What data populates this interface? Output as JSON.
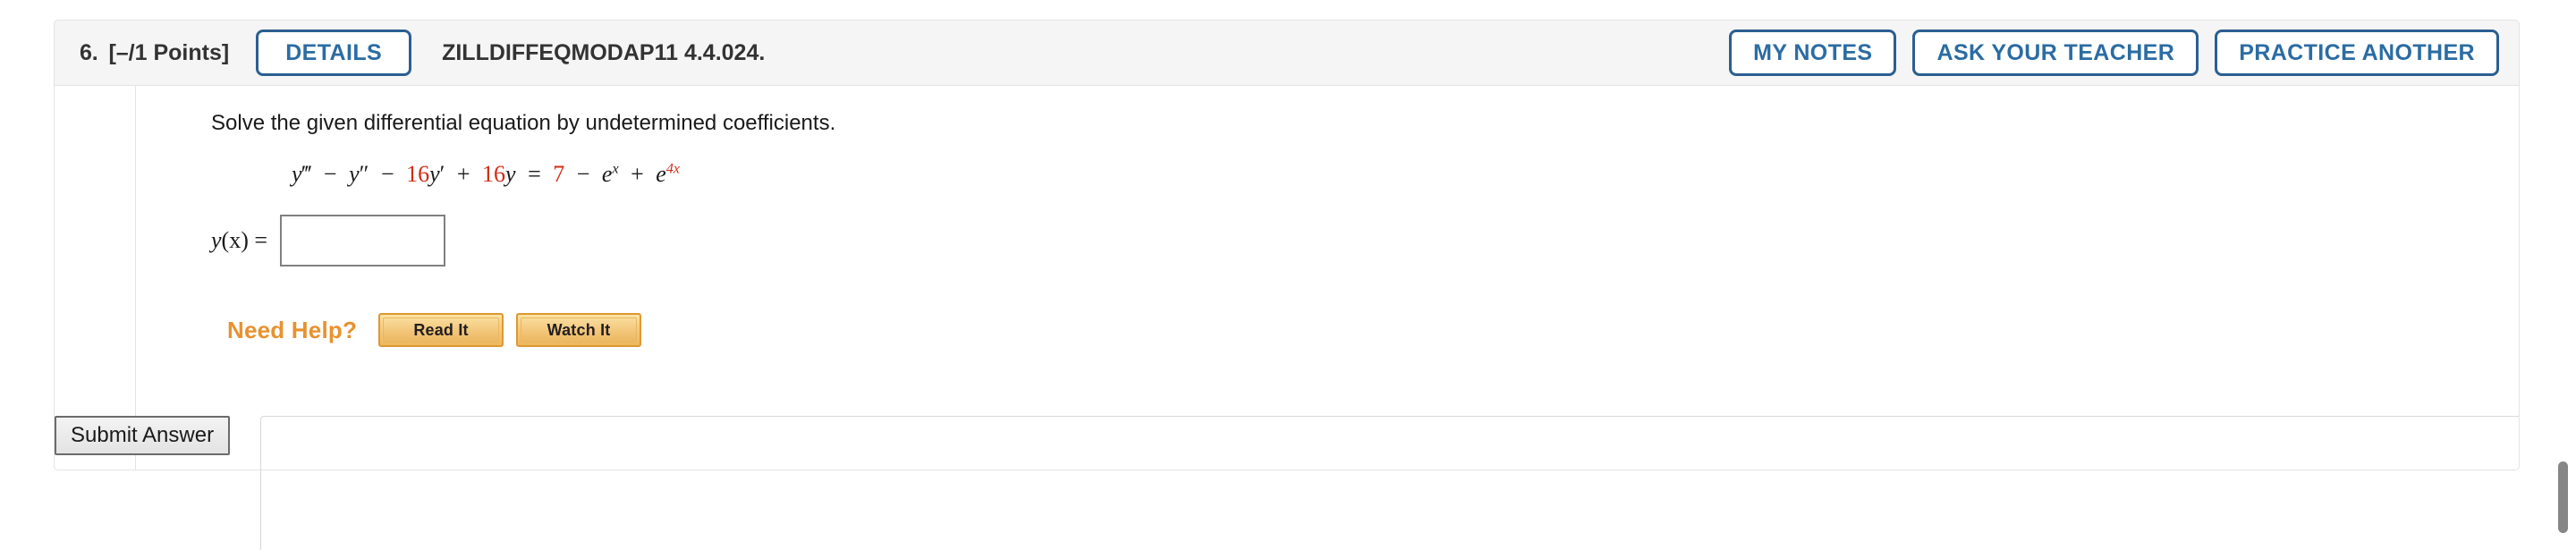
{
  "header": {
    "question_number": "6.",
    "points": "[–/1 Points]",
    "details_label": "DETAILS",
    "textbook_code": "ZILLDIFFEQMODAP11 4.4.024.",
    "right_buttons": [
      {
        "label": "MY NOTES",
        "name": "my-notes-button"
      },
      {
        "label": "ASK YOUR TEACHER",
        "name": "ask-your-teacher-button"
      },
      {
        "label": "PRACTICE ANOTHER",
        "name": "practice-another-button"
      }
    ]
  },
  "problem": {
    "prompt": "Solve the given differential equation by undetermined coefficients.",
    "equation": {
      "lhs_y3": "y",
      "lhs_y3_primes": "‴",
      "minus1": "−",
      "lhs_y2": "y",
      "lhs_y2_primes": "″",
      "minus2": "−",
      "coef_16a": "16",
      "lhs_y1": "y",
      "lhs_y1_prime": "′",
      "plus1": "+",
      "coef_16b": "16",
      "lhs_y0": "y",
      "equals": "=",
      "rhs_7": "7",
      "minus3": "−",
      "e1": "e",
      "e1_exp": "x",
      "plus2": "+",
      "e2": "e",
      "e2_exp": "4x"
    },
    "answer_label_y": "y",
    "answer_label_rest": "(x) =",
    "answer_value": "",
    "answer_placeholder": ""
  },
  "help": {
    "label": "Need Help?",
    "read_it": "Read It",
    "watch_it": "Watch It"
  },
  "submit": {
    "label": "Submit Answer"
  },
  "colors": {
    "accent_blue": "#2b5f91",
    "link_blue": "#2b6ca3",
    "header_bg": "#f5f5f5",
    "equation_red": "#d32a16",
    "help_orange": "#e8922e",
    "help_button_border": "#dd9933"
  }
}
